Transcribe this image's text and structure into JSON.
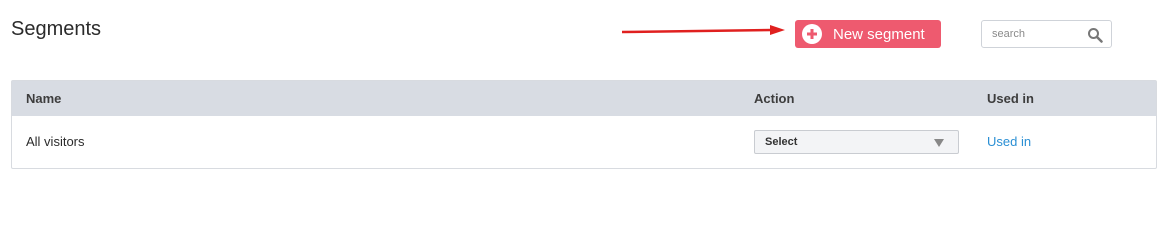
{
  "header": {
    "title": "Segments",
    "new_button_label": "New segment",
    "search_placeholder": "search"
  },
  "table": {
    "columns": [
      "Name",
      "Action",
      "Used in"
    ],
    "rows": [
      {
        "name": "All visitors",
        "action": "Select",
        "used_in": "Used in"
      }
    ]
  },
  "colors": {
    "accent": "#ee5a6f",
    "link": "#2a8fd4",
    "header_bg": "#d8dce3",
    "arrow": "#e0201f"
  },
  "icons": [
    "arrow-icon",
    "plus-circle-icon",
    "search-icon",
    "caret-down-icon"
  ]
}
